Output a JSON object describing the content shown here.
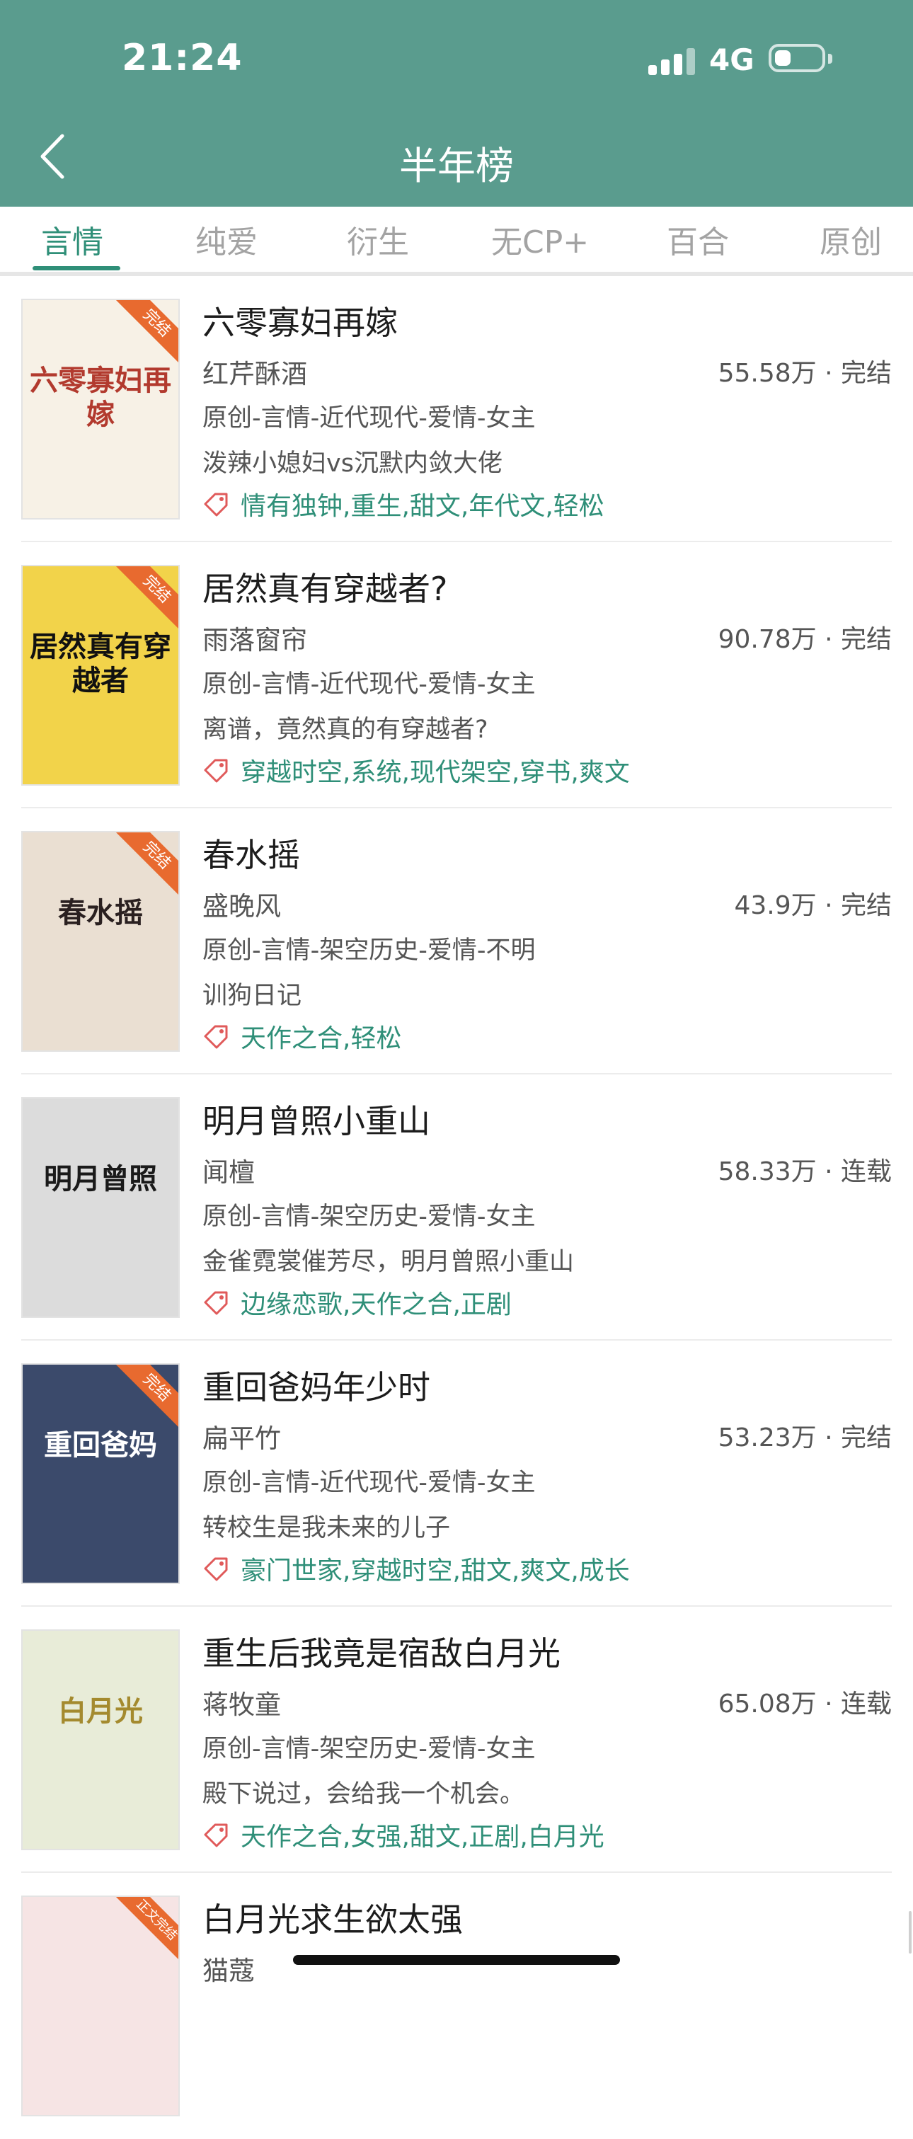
{
  "status_bar": {
    "time": "21:24",
    "network": "4G"
  },
  "header": {
    "title": "半年榜"
  },
  "tabs": [
    {
      "label": "言情",
      "active": true
    },
    {
      "label": "纯爱",
      "active": false
    },
    {
      "label": "衍生",
      "active": false
    },
    {
      "label": "无CP+",
      "active": false
    },
    {
      "label": "百合",
      "active": false
    },
    {
      "label": "原创",
      "active": false
    }
  ],
  "books": [
    {
      "title": "六零寡妇再嫁",
      "author": "红芹酥酒",
      "stats": "55.58万 · 完结",
      "category": "原创-言情-近代现代-爱情-女主",
      "intro": "泼辣小媳妇vs沉默内敛大佬",
      "tags": "情有独钟,重生,甜文,年代文,轻松",
      "cover_text": "六零寡妇再嫁",
      "cover_ribbon": "完结",
      "cover_bg": "#f7f1e6",
      "cover_fg": "#b23a2e"
    },
    {
      "title": "居然真有穿越者?",
      "author": "雨落窗帘",
      "stats": "90.78万 · 完结",
      "category": "原创-言情-近代现代-爱情-女主",
      "intro": "离谱，竟然真的有穿越者?",
      "tags": "穿越时空,系统,现代架空,穿书,爽文",
      "cover_text": "居然真有穿越者",
      "cover_ribbon": "完结",
      "cover_bg": "#f2d34a",
      "cover_fg": "#111111"
    },
    {
      "title": "春水摇",
      "author": "盛晚风",
      "stats": "43.9万 · 完结",
      "category": "原创-言情-架空历史-爱情-不明",
      "intro": "训狗日记",
      "tags": "天作之合,轻松",
      "cover_text": "春水摇",
      "cover_ribbon": "完结",
      "cover_bg": "#eadfd2",
      "cover_fg": "#2a2020"
    },
    {
      "title": "明月曾照小重山",
      "author": "闻檀",
      "stats": "58.33万 · 连载",
      "category": "原创-言情-架空历史-爱情-女主",
      "intro": "金雀霓裳催芳尽，明月曾照小重山",
      "tags": "边缘恋歌,天作之合,正剧",
      "cover_text": "明月曾照",
      "cover_ribbon": "",
      "cover_bg": "#dcdcdc",
      "cover_fg": "#1a1a1a"
    },
    {
      "title": "重回爸妈年少时",
      "author": "扁平竹",
      "stats": "53.23万 · 完结",
      "category": "原创-言情-近代现代-爱情-女主",
      "intro": "转校生是我未来的儿子",
      "tags": "豪门世家,穿越时空,甜文,爽文,成长",
      "cover_text": "重回爸妈",
      "cover_ribbon": "完结",
      "cover_bg": "#3b4a6b",
      "cover_fg": "#ffffff"
    },
    {
      "title": "重生后我竟是宿敌白月光",
      "author": "蒋牧童",
      "stats": "65.08万 · 连载",
      "category": "原创-言情-架空历史-爱情-女主",
      "intro": "殿下说过，会给我一个机会。",
      "tags": "天作之合,女强,甜文,正剧,白月光",
      "cover_text": "白月光",
      "cover_ribbon": "",
      "cover_bg": "#e8ecd8",
      "cover_fg": "#a48a2e"
    },
    {
      "title": "白月光求生欲太强",
      "author": "猫蔻",
      "stats": "",
      "category": "",
      "intro": "",
      "tags": "",
      "cover_text": "",
      "cover_ribbon": "正文完结",
      "cover_bg": "#f6e4e4",
      "cover_fg": "#333333"
    }
  ],
  "colors": {
    "header_bg": "#5a9c8e",
    "accent": "#2f8f78",
    "ribbon": "#e86a2f"
  }
}
